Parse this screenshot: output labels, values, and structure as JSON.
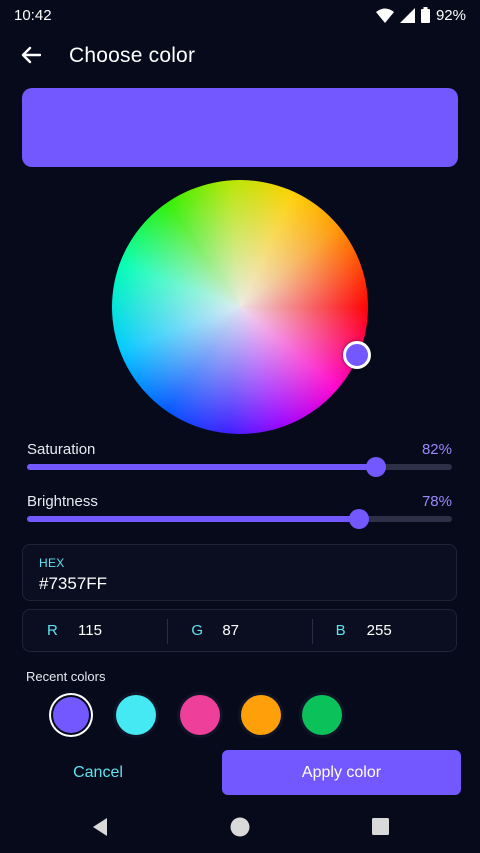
{
  "status_bar": {
    "time": "10:42",
    "battery": "92%",
    "icons": [
      "wifi-icon",
      "signal-icon",
      "battery-icon"
    ]
  },
  "app_bar": {
    "title": "Choose color",
    "back_icon": "arrow-left-icon"
  },
  "color": {
    "selected_hex": "#7357FF"
  },
  "sliders": [
    {
      "label": "Saturation",
      "value_text": "82%",
      "value": 0.82
    },
    {
      "label": "Brightness",
      "value_text": "78%",
      "value": 0.78
    }
  ],
  "hex_field": {
    "label": "HEX",
    "value": "#7357FF"
  },
  "rgb": [
    {
      "key": "R",
      "value": "115"
    },
    {
      "key": "G",
      "value": "87"
    },
    {
      "key": "B",
      "value": "255"
    }
  ],
  "recent": {
    "label": "Recent colors",
    "colors": [
      "#7357ff",
      "#45e9f3",
      "#ee3f9b",
      "#ffa00a",
      "#0ac15a"
    ]
  },
  "actions": {
    "cancel": "Cancel",
    "apply": "Apply color"
  },
  "nav": {
    "icons": [
      "back-triangle-icon",
      "home-circle-icon",
      "recents-square-icon"
    ]
  }
}
